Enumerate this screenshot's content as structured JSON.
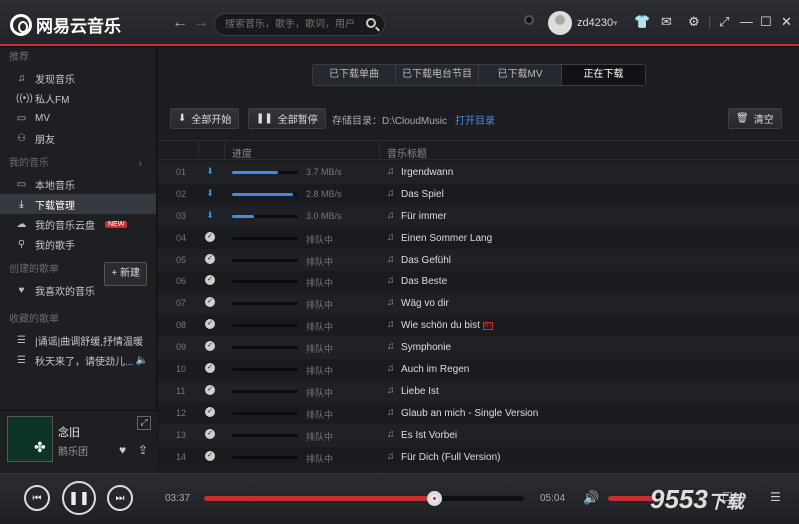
{
  "app": {
    "name": "网易云音乐"
  },
  "search": {
    "placeholder": "搜索音乐，歌手，歌词，用户"
  },
  "user": {
    "name": "zd4230"
  },
  "sidebar": {
    "sec_recommend": "推荐",
    "recommend": [
      {
        "icon": "music-note",
        "label": "发现音乐"
      },
      {
        "icon": "radio",
        "label": "私人FM"
      },
      {
        "icon": "mv",
        "label": "MV"
      },
      {
        "icon": "friends",
        "label": "朋友"
      }
    ],
    "sec_mymusic": "我的音乐",
    "mymusic": [
      {
        "icon": "monitor",
        "label": "本地音乐"
      },
      {
        "icon": "download",
        "label": "下载管理"
      },
      {
        "icon": "cloud",
        "label": "我的音乐云盘",
        "badge": "NEW"
      },
      {
        "icon": "person",
        "label": "我的歌手"
      }
    ],
    "sec_created": "创建的歌单",
    "new_label": "+ 新建",
    "created": [
      {
        "icon": "heart",
        "label": "我喜欢的音乐"
      }
    ],
    "sec_collected": "收藏的歌单",
    "collected": [
      {
        "icon": "playlist",
        "label": "|诵谣|曲调舒缓,抒情温暖"
      },
      {
        "icon": "playlist",
        "label": "秋天来了，请使劲儿..."
      }
    ]
  },
  "now_playing": {
    "title": "念旧",
    "artist": "鹅乐团"
  },
  "tabs": [
    {
      "label": "已下载单曲"
    },
    {
      "label": "已下载电台节目"
    },
    {
      "label": "已下载MV"
    },
    {
      "label": "正在下载",
      "active": true
    }
  ],
  "toolbar": {
    "start_all": "全部开始",
    "pause_all": "全部暂停",
    "dir_label": "存储目录：",
    "dir_path": "D:\\CloudMusic",
    "open_dir": "打开目录",
    "clear": "清空"
  },
  "table": {
    "col_progress": "进度",
    "col_title": "音乐标题"
  },
  "downloads": [
    {
      "no": "01",
      "status": "downloading",
      "progress": 0.7,
      "speed": "3.7 MB/s",
      "title": "Irgendwann"
    },
    {
      "no": "02",
      "status": "downloading",
      "progress": 0.92,
      "speed": "2.8 MB/s",
      "title": "Das Spiel"
    },
    {
      "no": "03",
      "status": "downloading",
      "progress": 0.33,
      "speed": "3.0 MB/s",
      "title": "Für immer"
    },
    {
      "no": "04",
      "status": "queued",
      "progress": 0,
      "speed": "排队中",
      "title": "Einen Sommer Lang"
    },
    {
      "no": "05",
      "status": "queued",
      "progress": 0,
      "speed": "排队中",
      "title": "Das Gefühl"
    },
    {
      "no": "06",
      "status": "queued",
      "progress": 0,
      "speed": "排队中",
      "title": "Das Beste"
    },
    {
      "no": "07",
      "status": "queued",
      "progress": 0,
      "speed": "排队中",
      "title": "Wäg vo dir"
    },
    {
      "no": "08",
      "status": "queued",
      "progress": 0,
      "speed": "排队中",
      "title": "Wie schön du bist",
      "mv": "MV"
    },
    {
      "no": "09",
      "status": "queued",
      "progress": 0,
      "speed": "排队中",
      "title": "Symphonie"
    },
    {
      "no": "10",
      "status": "queued",
      "progress": 0,
      "speed": "排队中",
      "title": "Auch im Regen"
    },
    {
      "no": "11",
      "status": "queued",
      "progress": 0,
      "speed": "排队中",
      "title": "Liebe Ist"
    },
    {
      "no": "12",
      "status": "queued",
      "progress": 0,
      "speed": "排队中",
      "title": "Glaub an mich - Single Version"
    },
    {
      "no": "13",
      "status": "queued",
      "progress": 0,
      "speed": "排队中",
      "title": "Es Ist Vorbei"
    },
    {
      "no": "14",
      "status": "queued",
      "progress": 0,
      "speed": "排队中",
      "title": "Für Dich (Full Version)"
    }
  ],
  "player": {
    "elapsed": "03:37",
    "total": "05:04",
    "progress": 0.72,
    "volume": 0.65
  },
  "watermark": "9553下载",
  "colors": {
    "accent": "#c62f2f",
    "download_blue": "#3a8ee6",
    "link": "#4a8bd8"
  }
}
